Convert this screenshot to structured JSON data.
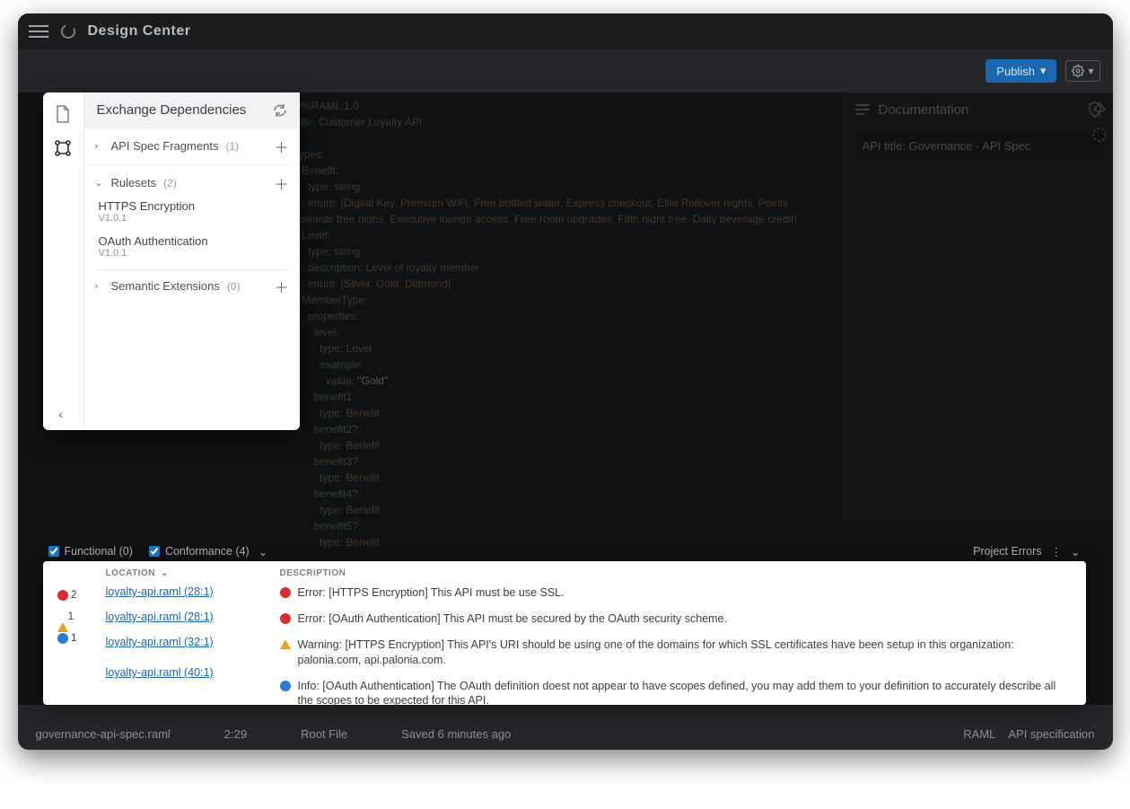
{
  "header": {
    "app_name": "Design Center"
  },
  "toolbar": {
    "publish_label": "Publish"
  },
  "documentation": {
    "panel_title": "Documentation",
    "api_title_label": "API title: Governance - API Spec"
  },
  "popover": {
    "title": "Exchange Dependencies",
    "sections": {
      "fragments": {
        "label": "API Spec Fragments",
        "count": "(1)"
      },
      "rulesets": {
        "label": "Rulesets",
        "count": "(2)"
      },
      "semantics": {
        "label": "Semantic Extensions",
        "count": "(0)"
      }
    },
    "ruleset_items": [
      {
        "name": "HTTPS Encryption",
        "version": "V1.0.1"
      },
      {
        "name": "OAuth Authentication",
        "version": "V1.0.1"
      }
    ]
  },
  "editor_code": "#%RAML 1.0\ntitle: Customer Loyalty API\n\ntypes:\n  Benefit:\n    type: string\n    enum: [Digital Key, Premium WiFi, Free bottled water, Express checkout, Elite Rollover nights, Points\ntowards free nighs, Executive lounge access, Free room upgrades, Fifth night free, Daily beverage credit]\n  Level:\n    type: string\n    description: Level of loyalty member\n    enum: [Silver, Gold, Diamond]\n  MemberType:\n    properties:\n      level:\n        type: Level\n        example:\n          value: \"Gold\"\n      benefit1:\n        type: Benefit\n      benefit2?:\n        type: Benefit\n      benefit3?:\n        type: Benefit\n      benefit4?:\n        type: Benefit\n      benefit5?:\n        type: Benefit",
  "problems": {
    "tabs": {
      "functional": "Functional (0)",
      "conformance": "Conformance (4)"
    },
    "right_label": "Project Errors",
    "counts": {
      "errors": "2",
      "warnings": "1",
      "infos": "1"
    },
    "headers": {
      "location": "LOCATION",
      "description": "DESCRIPTION"
    },
    "rows": [
      {
        "location": "loyalty-api.raml (28:1)",
        "severity": "error",
        "description": "Error: [HTTPS Encryption] This API must be use SSL."
      },
      {
        "location": "loyalty-api.raml (28:1)",
        "severity": "error",
        "description": "Error: [OAuth Authentication] This API must be secured by the OAuth security scheme."
      },
      {
        "location": "loyalty-api.raml (32:1)",
        "severity": "warning",
        "description": "Warning: [HTTPS Encryption] This API's URI should be using one of the domains for which SSL certificates have been setup in this organization: palonia.com, api.palonia.com."
      },
      {
        "location": "loyalty-api.raml (40:1)",
        "severity": "info",
        "description": "Info: [OAuth Authentication] The OAuth definition doest not appear to have scopes defined, you may add them to your definition to accurately describe all the scopes to be expected for this API."
      }
    ]
  },
  "statusbar": {
    "file": "governance-api-spec.raml",
    "pos": "2:29",
    "root": "Root File",
    "saved": "Saved 6 minutes ago",
    "lang": "RAML",
    "spec": "API specification"
  }
}
